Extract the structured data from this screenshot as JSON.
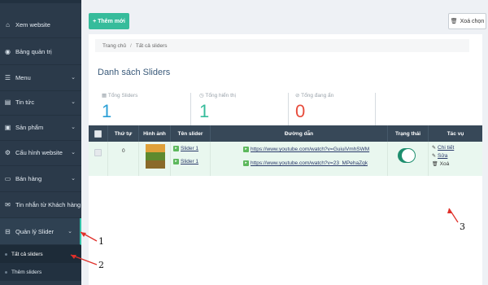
{
  "sidebar": {
    "items": [
      {
        "label": "Xem website",
        "icon": "home-icon",
        "glyph": "⌂",
        "chevron": false
      },
      {
        "label": "Bảng quản trị",
        "icon": "dashboard-icon",
        "glyph": "◉",
        "chevron": false
      },
      {
        "label": "Menu",
        "icon": "menu-icon",
        "glyph": "☰",
        "chevron": true
      },
      {
        "label": "Tin tức",
        "icon": "news-icon",
        "glyph": "▤",
        "chevron": true
      },
      {
        "label": "Sản phẩm",
        "icon": "product-icon",
        "glyph": "▣",
        "chevron": true
      },
      {
        "label": "Cấu hình website",
        "icon": "settings-icon",
        "glyph": "⚙",
        "chevron": true
      },
      {
        "label": "Bán hàng",
        "icon": "sales-icon",
        "glyph": "▭",
        "chevron": true
      },
      {
        "label": "Tin nhắn từ Khách hàng",
        "icon": "message-icon",
        "glyph": "✉",
        "chevron": false
      },
      {
        "label": "Quản lý Slider",
        "icon": "slider-icon",
        "glyph": "⊟",
        "chevron": true
      }
    ],
    "sub_items": [
      {
        "label": "Tất cả sliders"
      },
      {
        "label": "Thêm sliders"
      }
    ]
  },
  "toolbar": {
    "add_label": "+ Thêm mới",
    "delete_label": "Xoá chọn"
  },
  "breadcrumb": {
    "home": "Trang chủ",
    "separator": "/",
    "current": "Tất cả sliders"
  },
  "list_title": "Danh sách Sliders",
  "stats": [
    {
      "label": "Tổng Sliders",
      "value": "1",
      "color": "#2a9fd6"
    },
    {
      "label": "Tổng hiển thị",
      "value": "1",
      "color": "#36bc9b"
    },
    {
      "label": "Tổng đang ẩn",
      "value": "0",
      "color": "#e74c3c"
    }
  ],
  "table": {
    "headers": [
      "",
      "Thứ tự",
      "Hình ảnh",
      "Tên slider",
      "Đường dẫn",
      "Trạng thái",
      "Tác vụ"
    ],
    "rows": [
      {
        "order": "0",
        "names": [
          "Slider 1",
          "Slider 1"
        ],
        "links": [
          "https://www.youtube.com/watch?v=GuiuiVmhSWM",
          "https://www.youtube.com/watch?v=23_MPehaZqk"
        ],
        "status_on": true,
        "actions": [
          "Chi tiết",
          "Sửa",
          "Xoá"
        ]
      }
    ]
  },
  "annotations": [
    "1",
    "2",
    "3"
  ],
  "colors": {
    "accent": "#36bc9b",
    "sidebar_bg": "#2b3a4a",
    "annotation": "#e0302a"
  }
}
